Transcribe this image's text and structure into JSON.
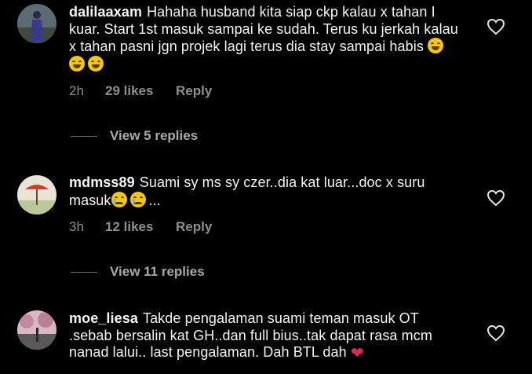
{
  "comments": [
    {
      "username": "dalilaaxam",
      "text": "Hahaha husband kita siap ckp kalau x tahan I kuar. Start 1st masuk sampai ke sudah. Terus ku jerkah kalau x tahan pasni jgn projek lagi terus dia stay sampai habis",
      "emojis": [
        "rofl-emoji",
        "rofl-emoji",
        "rofl-emoji"
      ],
      "time": "2h",
      "likes": "29 likes",
      "reply_label": "Reply",
      "view_replies": "View 5 replies"
    },
    {
      "username": "mdmss89",
      "text": "Suami sy ms sy czer..dia kat luar...doc x suru masuk",
      "emojis": [
        "crying-emoji",
        "crying-emoji"
      ],
      "text_suffix": "...",
      "time": "3h",
      "likes": "12 likes",
      "reply_label": "Reply",
      "view_replies": "View 11 replies"
    },
    {
      "username": "moe_liesa",
      "text": "Takde pengalaman suami teman masuk OT .sebab bersalin kat GH..dan full bius..tak dapat rasa mcm nanad lalui.. last pengalaman. Dah BTL dah",
      "emojis": [
        "red-heart-emoji"
      ]
    }
  ],
  "colors": {
    "background": "#000000",
    "text": "#f5f5f5",
    "meta": "#8e8e8e",
    "heart_emoji": "#e0245e"
  }
}
